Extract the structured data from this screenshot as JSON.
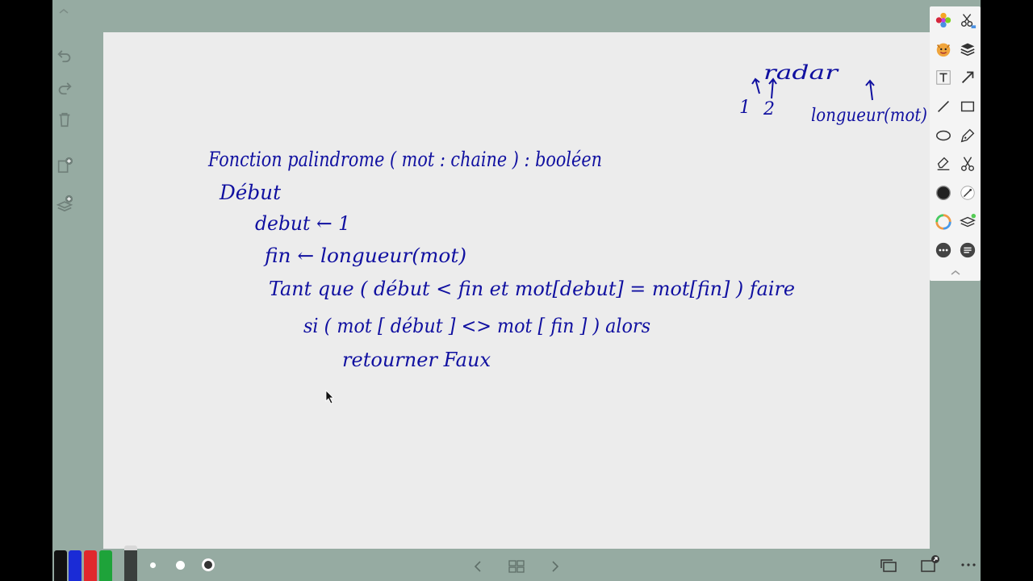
{
  "canvas": {
    "lines": [
      "Fonction palindrome ( mot : chaine ) : booléen",
      "Début",
      "debut ← 1",
      "fin ← longueur(mot)",
      "Tant que ( début < fin et mot[debut] = mot[fin] ) faire",
      "si ( mot [ début ] <> mot [ fin ] ) alors",
      "retourner Faux"
    ],
    "annotation": {
      "word": "radar",
      "index_first": "1",
      "index_second": "2",
      "index_last": "longueur(mot)"
    }
  },
  "colors": {
    "ink": "#1010a0",
    "frame": "#96aba2",
    "paper": "#ececec",
    "pen_black": "#111111",
    "pen_blue": "#1a2bd6",
    "pen_red": "#e0282c",
    "pen_green": "#1ea33a"
  },
  "icons": {
    "left": [
      "undo-icon",
      "redo-icon",
      "trash-icon",
      "add-page-icon",
      "add-layer-icon"
    ],
    "right": [
      "photos-icon",
      "cut-select-icon",
      "emoji-icon",
      "layers-icon",
      "text-icon",
      "arrow-icon",
      "line-icon",
      "rectangle-icon",
      "ellipse-icon",
      "pen-icon",
      "highlighter-icon",
      "scissors-icon",
      "color-fill-icon",
      "eyedropper-icon",
      "color-wheel-icon",
      "stack-icon",
      "more-icon",
      "list-icon"
    ]
  }
}
